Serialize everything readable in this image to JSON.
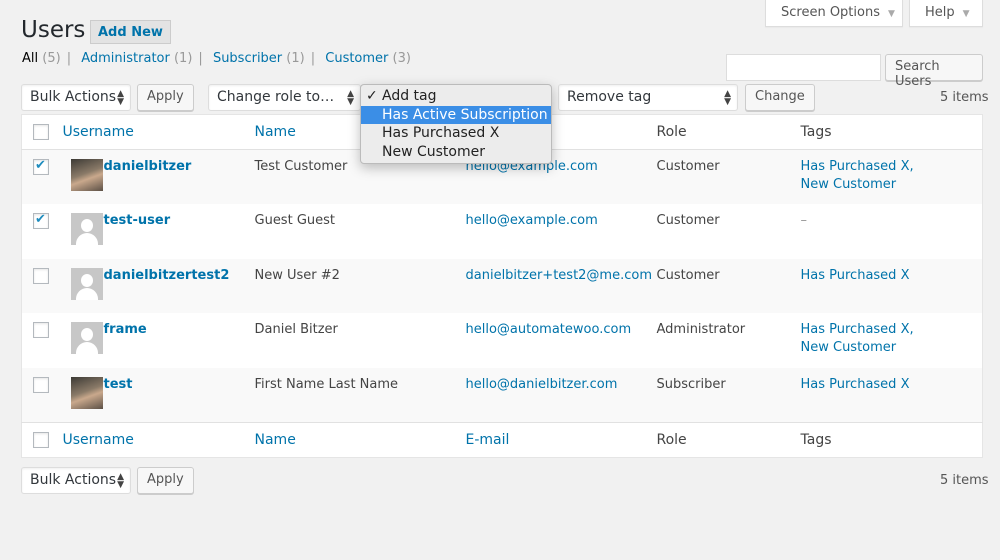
{
  "header": {
    "screen_options": "Screen Options",
    "help": "Help"
  },
  "title": "Users",
  "add_new": "Add New",
  "filters": [
    {
      "label": "All",
      "count": "(5)"
    },
    {
      "label": "Administrator",
      "count": "(1)"
    },
    {
      "label": "Subscriber",
      "count": "(1)"
    },
    {
      "label": "Customer",
      "count": "(3)"
    }
  ],
  "search": {
    "value": "",
    "button": "Search Users"
  },
  "toolbar": {
    "bulk_actions": "Bulk Actions",
    "apply": "Apply",
    "change_role": "Change role to…",
    "remove_tag": "Remove tag",
    "change": "Change",
    "items": "5 items"
  },
  "tag_dropdown": {
    "options": [
      "Add tag",
      "Has Active Subscription",
      "Has Purchased X",
      "New Customer"
    ],
    "selected": "Add tag",
    "highlighted": "Has Active Subscription",
    "check": "✓"
  },
  "columns": {
    "username": "Username",
    "name": "Name",
    "email": "E-mail",
    "role": "Role",
    "tags": "Tags"
  },
  "users": [
    {
      "username": "danielbitzer",
      "name": "Test Customer",
      "email": "hello@example.com",
      "role": "Customer",
      "tags": "Has Purchased X, New Customer",
      "checked": true,
      "avatar": "photo"
    },
    {
      "username": "test-user",
      "name": "Guest Guest",
      "email": "hello@example.com",
      "role": "Customer",
      "tags": "–",
      "checked": true,
      "avatar": "default"
    },
    {
      "username": "danielbitzertest2",
      "name": "New User #2",
      "email": "danielbitzer+test2@me.com",
      "role": "Customer",
      "tags": "Has Purchased X",
      "checked": false,
      "avatar": "default"
    },
    {
      "username": "frame",
      "name": "Daniel Bitzer",
      "email": "hello@automatewoo.com",
      "role": "Administrator",
      "tags": "Has Purchased X, New Customer",
      "checked": false,
      "avatar": "default"
    },
    {
      "username": "test",
      "name": "First Name Last Name",
      "email": "hello@danielbitzer.com",
      "role": "Subscriber",
      "tags": "Has Purchased X",
      "checked": false,
      "avatar": "photo"
    }
  ]
}
